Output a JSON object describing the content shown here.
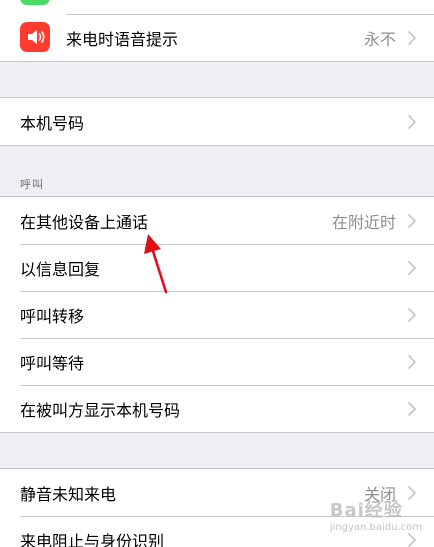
{
  "top_group": {
    "rows": [
      {
        "label": "来电时语音提示",
        "detail": "永不"
      }
    ]
  },
  "number_group": {
    "rows": [
      {
        "label": "本机号码",
        "detail": ""
      }
    ]
  },
  "calls_section": {
    "header": "呼叫",
    "rows": [
      {
        "label": "在其他设备上通话",
        "detail": "在附近时"
      },
      {
        "label": "以信息回复",
        "detail": ""
      },
      {
        "label": "呼叫转移",
        "detail": ""
      },
      {
        "label": "呼叫等待",
        "detail": ""
      },
      {
        "label": "在被叫方显示本机号码",
        "detail": ""
      }
    ]
  },
  "bottom_group": {
    "rows": [
      {
        "label": "静音未知来电",
        "detail": "关闭"
      },
      {
        "label": "来电阻止与身份识别",
        "detail": ""
      }
    ]
  },
  "watermark": {
    "brand": "Bai经验",
    "url": "jingyan.baidu.com"
  },
  "colors": {
    "background": "#efeff4",
    "row_background": "#ffffff",
    "separator": "#c8c7cc",
    "detail_text": "#8e8e93",
    "chevron": "#c7c7cc",
    "announce_icon": "#ff3b30",
    "top_partial_icon": "#4cd964",
    "annotation_arrow": "#e0101a"
  },
  "icons": {
    "announce": "speaker-wave-icon",
    "chevron": "chevron-right-icon"
  }
}
